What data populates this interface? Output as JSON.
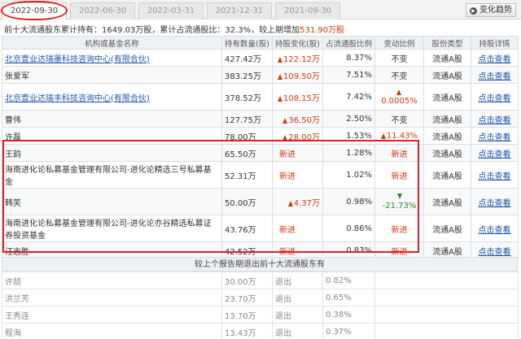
{
  "tabs": [
    {
      "label": "2022-09-30",
      "active": true
    },
    {
      "label": "2022-06-30",
      "active": false
    },
    {
      "label": "2022-03-31",
      "active": false
    },
    {
      "label": "2021-12-31",
      "active": false
    },
    {
      "label": "2021-09-30",
      "active": false
    }
  ],
  "trend_button": {
    "label": "变化趋势",
    "icon": "play-circle-icon"
  },
  "summary": {
    "prefix": "前十大流通股东累计持有：",
    "shares": "1649.03万股",
    "ratio_text": "，累计占流通股比：32.3%，",
    "change_prefix": "较上期增加",
    "change": "531.90万股"
  },
  "table": {
    "headers": [
      "机构或基金名称",
      "持有数量(股)",
      "持股变化(股)",
      "占流通股比例",
      "变动比例",
      "股份类型",
      "持股详情"
    ],
    "rows": [
      {
        "name": "北京壹业达瑞墨科技咨询中心(有限合伙)",
        "link": true,
        "qty": "427.42万",
        "change": "122.12万",
        "change_dir": "up",
        "pct": "8.37%",
        "var": "不变",
        "var_dir": "none",
        "type": "流通A股",
        "detail": "点击查看",
        "tall": false
      },
      {
        "name": "张爱军",
        "link": false,
        "qty": "383.25万",
        "change": "109.50万",
        "change_dir": "up",
        "pct": "7.51%",
        "var": "不变",
        "var_dir": "none",
        "type": "流通A股",
        "detail": "点击查看",
        "tall": false
      },
      {
        "name": "北京壹业达瑞丰科技咨询中心(有限合伙)",
        "link": true,
        "qty": "378.52万",
        "change": "108.15万",
        "change_dir": "up",
        "pct": "7.42%",
        "var": "0.0005%",
        "var_dir": "up",
        "type": "流通A股",
        "detail": "点击查看",
        "tall": true
      },
      {
        "name": "曹伟",
        "link": false,
        "qty": "127.75万",
        "change": "36.50万",
        "change_dir": "up",
        "pct": "2.50%",
        "var": "不变",
        "var_dir": "none",
        "type": "流通A股",
        "detail": "点击查看",
        "tall": false
      },
      {
        "name": "许磊",
        "link": false,
        "qty": "78.00万",
        "change": "28.00万",
        "change_dir": "up",
        "pct": "1.53%",
        "var": "11.43%",
        "var_dir": "up-inline",
        "type": "流通A股",
        "detail": "点击查看",
        "tall": false
      },
      {
        "name": "王韵",
        "link": false,
        "qty": "65.50万",
        "change": "新进",
        "change_dir": "new",
        "pct": "1.28%",
        "var": "新进",
        "var_dir": "new",
        "type": "流通A股",
        "detail": "点击查看",
        "tall": false
      },
      {
        "name": "海南进化论私募基金管理有限公司-进化论精选三号私募基金",
        "link": false,
        "qty": "52.31万",
        "change": "新进",
        "change_dir": "new",
        "pct": "1.02%",
        "var": "新进",
        "var_dir": "new",
        "type": "流通A股",
        "detail": "点击查看",
        "tall": true
      },
      {
        "name": "韩笑",
        "link": false,
        "qty": "50.00万",
        "change": "4.37万",
        "change_dir": "up",
        "pct": "0.98%",
        "var": "-21.73%",
        "var_dir": "down",
        "type": "流通A股",
        "detail": "点击查看",
        "tall": true
      },
      {
        "name": "海南进化论私募基金管理有限公司-进化论亦谷精选私募证券投资基金",
        "link": false,
        "qty": "43.76万",
        "change": "新进",
        "change_dir": "new",
        "pct": "0.86%",
        "var": "新进",
        "var_dir": "new",
        "type": "流通A股",
        "detail": "点击查看",
        "tall": true
      },
      {
        "name": "汪志胜",
        "link": false,
        "qty": "42.52万",
        "change": "新进",
        "change_dir": "new",
        "pct": "0.83%",
        "var": "新进",
        "var_dir": "new",
        "type": "流通A股",
        "detail": "点击查看",
        "tall": false
      }
    ]
  },
  "exits": {
    "title": "较上个报告期退出前十大流通股东有",
    "rows": [
      {
        "name": "许喆",
        "qty": "30.00万",
        "status": "退出",
        "pct": "0.82%"
      },
      {
        "name": "洪兰芳",
        "qty": "23.70万",
        "status": "退出",
        "pct": "0.65%"
      },
      {
        "name": "王秀连",
        "qty": "13.70万",
        "status": "退出",
        "pct": "0.38%"
      },
      {
        "name": "程海",
        "qty": "13.43万",
        "status": "退出",
        "pct": "0.37%"
      }
    ]
  },
  "colors": {
    "accent_red": "#d4380d",
    "link_blue": "#1a56b0",
    "down_green": "#2e8b2e",
    "annotation_red": "#e02020"
  }
}
